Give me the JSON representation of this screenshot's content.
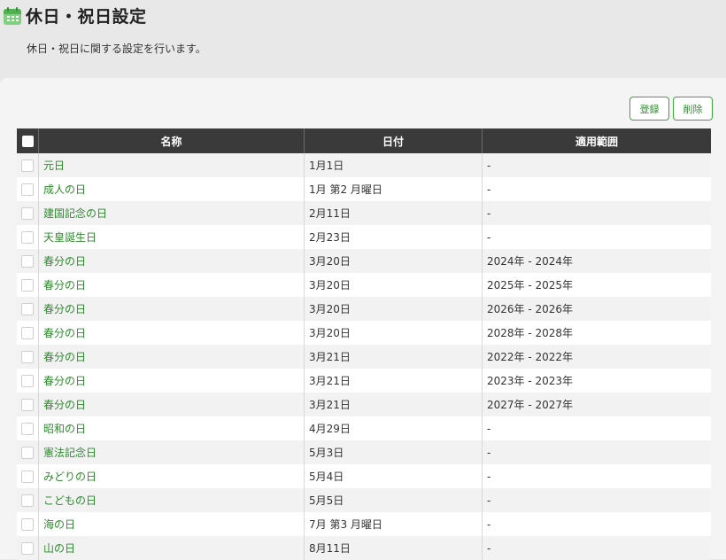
{
  "header": {
    "title": "休日・祝日設定",
    "description": "休日・祝日に関する設定を行います。"
  },
  "toolbar": {
    "register_label": "登録",
    "delete_label": "削除"
  },
  "table": {
    "columns": [
      "名称",
      "日付",
      "適用範囲"
    ],
    "rows": [
      {
        "name": "元日",
        "date": "1月1日",
        "range": "-"
      },
      {
        "name": "成人の日",
        "date": "1月 第2 月曜日",
        "range": "-"
      },
      {
        "name": "建国記念の日",
        "date": "2月11日",
        "range": "-"
      },
      {
        "name": "天皇誕生日",
        "date": "2月23日",
        "range": "-"
      },
      {
        "name": "春分の日",
        "date": "3月20日",
        "range": "2024年 - 2024年"
      },
      {
        "name": "春分の日",
        "date": "3月20日",
        "range": "2025年 - 2025年"
      },
      {
        "name": "春分の日",
        "date": "3月20日",
        "range": "2026年 - 2026年"
      },
      {
        "name": "春分の日",
        "date": "3月20日",
        "range": "2028年 - 2028年"
      },
      {
        "name": "春分の日",
        "date": "3月21日",
        "range": "2022年 - 2022年"
      },
      {
        "name": "春分の日",
        "date": "3月21日",
        "range": "2023年 - 2023年"
      },
      {
        "name": "春分の日",
        "date": "3月21日",
        "range": "2027年 - 2027年"
      },
      {
        "name": "昭和の日",
        "date": "4月29日",
        "range": "-"
      },
      {
        "name": "憲法記念日",
        "date": "5月3日",
        "range": "-"
      },
      {
        "name": "みどりの日",
        "date": "5月4日",
        "range": "-"
      },
      {
        "name": "こどもの日",
        "date": "5月5日",
        "range": "-"
      },
      {
        "name": "海の日",
        "date": "7月 第3 月曜日",
        "range": "-"
      },
      {
        "name": "山の日",
        "date": "8月11日",
        "range": "-"
      }
    ]
  },
  "colors": {
    "accent": "#2e8b2e",
    "header_bg": "#3a3a3a",
    "icon": "#6cc66c"
  },
  "icons": {
    "title_icon": "calendar-icon"
  }
}
